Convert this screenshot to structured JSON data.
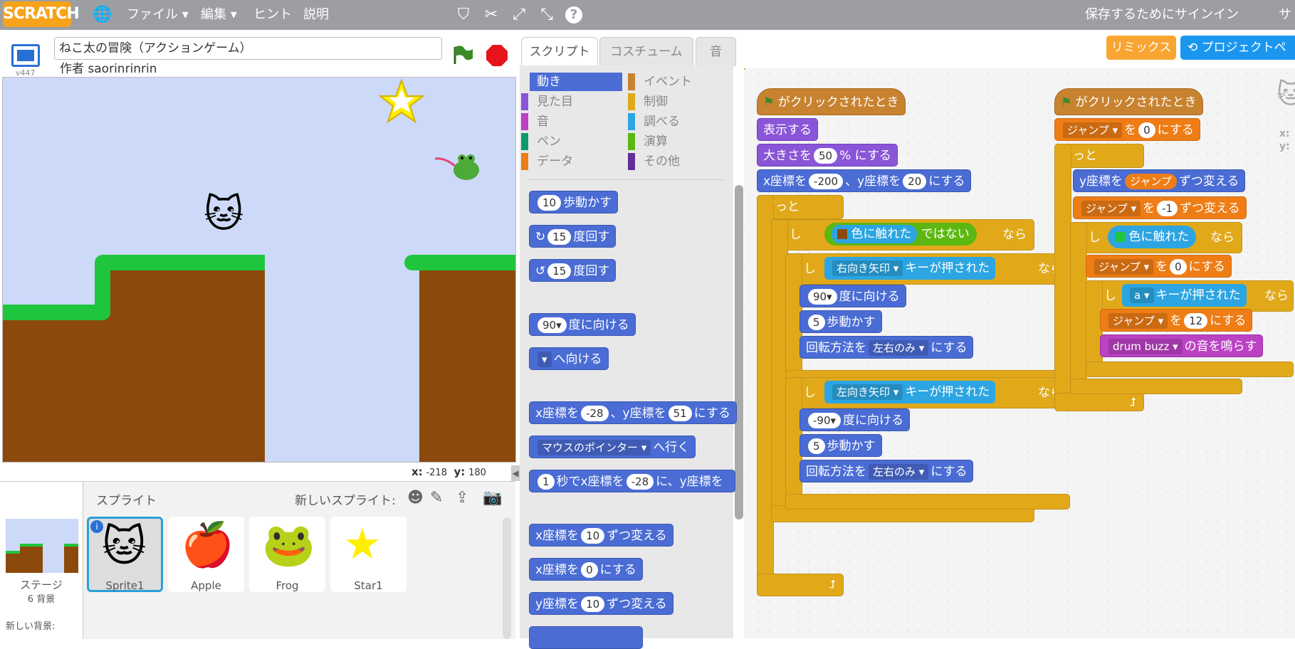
{
  "topbar": {
    "logo": "SCRATCH",
    "menu": [
      "ファイル ▾",
      "編集 ▾",
      "ヒント",
      "説明"
    ],
    "signin": "保存するためにサインイン",
    "signin_extra": "サ"
  },
  "stage_header": {
    "title_value": "ねこ太の冒険（アクションゲーム）",
    "author": "作者 saorinrinrin",
    "version": "v447"
  },
  "stage_info": {
    "x_label": "x:",
    "x_value": "-218",
    "y_label": "y:",
    "y_value": "180"
  },
  "sprite_panel": {
    "label": "スプライト",
    "new_sprite": "新しいスプライト:",
    "stage_label": "ステージ",
    "stage_backdrops": "6 背景",
    "new_backdrop": "新しい背景:",
    "sprites": [
      "Sprite1",
      "Apple",
      "Frog",
      "Star1"
    ]
  },
  "tabs": {
    "script": "スクリプト",
    "costume": "コスチューム",
    "sound": "音"
  },
  "buttons": {
    "remix": "リミックス",
    "project": "プロジェクトペ"
  },
  "categories": [
    {
      "label": "動き",
      "color": "#4a6cd4"
    },
    {
      "label": "イベント",
      "color": "#c88330"
    },
    {
      "label": "見た目",
      "color": "#8a55d7"
    },
    {
      "label": "制御",
      "color": "#e1a91a"
    },
    {
      "label": "音",
      "color": "#bb42c3"
    },
    {
      "label": "調べる",
      "color": "#2ca5e2"
    },
    {
      "label": "ペン",
      "color": "#0e9a6c"
    },
    {
      "label": "演算",
      "color": "#5cb712"
    },
    {
      "label": "データ",
      "color": "#ee7d16"
    },
    {
      "label": "その他",
      "color": "#632d99"
    }
  ],
  "palette": {
    "move": [
      "10",
      "歩動かす"
    ],
    "turn_r": [
      "15",
      "度回す"
    ],
    "turn_l": [
      "15",
      "度回す"
    ],
    "point": [
      "90▾",
      "度に向ける"
    ],
    "point_to": [
      "▾",
      "へ向ける"
    ],
    "goto_xy": [
      "x座標を",
      "-28",
      "、y座標を",
      "51",
      "にする"
    ],
    "goto": [
      "マウスのポインター ▾",
      "へ行く"
    ],
    "glide": [
      "1",
      "秒でx座標を",
      "-28",
      "に、y座標を"
    ],
    "change_x": [
      "x座標を",
      "10",
      "ずつ変える"
    ],
    "set_x": [
      "x座標を",
      "0",
      "にする"
    ],
    "change_y": [
      "y座標を",
      "10",
      "ずつ変える"
    ]
  },
  "script1": {
    "hat": "がクリックされたとき",
    "show": "表示する",
    "size": [
      "大きさを",
      "50",
      "% にする"
    ],
    "goto": [
      "x座標を",
      "-200",
      "、y座標を",
      "20",
      "にする"
    ],
    "forever": "ずっと",
    "if": "もし",
    "then": "なら",
    "touch_color": "色に触れた",
    "not": "ではない",
    "right_key": "右向き矢印 ▾",
    "left_key": "左向き矢印 ▾",
    "key_pressed": "キーが押された",
    "point90": [
      "90▾",
      "度に向ける"
    ],
    "pointm90": [
      "-90▾",
      "度に向ける"
    ],
    "move5": [
      "5",
      "歩動かす"
    ],
    "rot_style": [
      "回転方法を",
      "左右のみ ▾",
      "にする"
    ]
  },
  "script2": {
    "hat": "がクリックされたとき",
    "set_jump": [
      "ジャンプ ▾",
      "を",
      "0",
      "にする"
    ],
    "forever": "ずっと",
    "change_y": [
      "y座標を",
      "ジャンプ",
      "ずつ変える"
    ],
    "change_jump": [
      "ジャンプ ▾",
      "を",
      "-1",
      "ずつ変える"
    ],
    "if": "もし",
    "then": "なら",
    "touch_color": "色に触れた",
    "set_jump0": [
      "ジャンプ ▾",
      "を",
      "0",
      "にする"
    ],
    "key_a": [
      "a ▾",
      "キーが押された"
    ],
    "set_jump12": [
      "ジャンプ ▾",
      "を",
      "12",
      "にする"
    ],
    "sound": [
      "drum buzz ▾",
      "の音を鳴らす"
    ],
    "xy_hint": [
      "x:",
      "y:"
    ]
  }
}
